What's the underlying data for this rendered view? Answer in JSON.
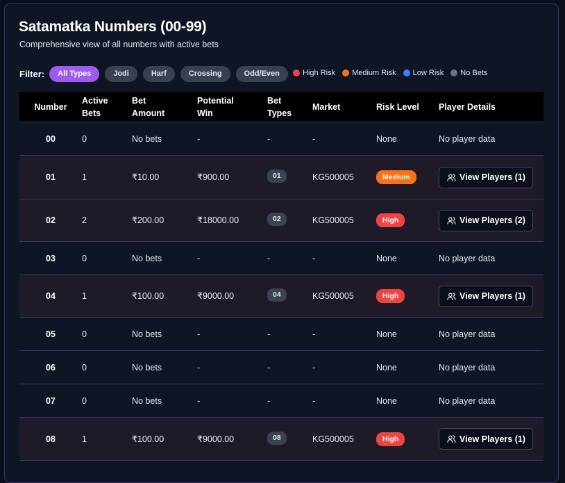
{
  "header": {
    "title": "Satamatka Numbers (00-99)",
    "subtitle": "Comprehensive view of all numbers with active bets"
  },
  "filter": {
    "label": "Filter:",
    "chips": [
      "All Types",
      "Jodi",
      "Harf",
      "Crossing",
      "Odd/Even"
    ],
    "active": "All Types"
  },
  "legend": [
    {
      "label": "High Risk",
      "color": "#ef4444"
    },
    {
      "label": "Medium Risk",
      "color": "#f97316"
    },
    {
      "label": "Low Risk",
      "color": "#3b82f6"
    },
    {
      "label": "No Bets",
      "color": "#6b7280"
    }
  ],
  "table": {
    "columns": {
      "number": "Number",
      "active_bets_1": "Active",
      "active_bets_2": "Bets",
      "bet_amount_1": "Bet",
      "bet_amount_2": "Amount",
      "potential_win_1": "Potential",
      "potential_win_2": "Win",
      "bet_types_1": "Bet",
      "bet_types_2": "Types",
      "market": "Market",
      "risk_level": "Risk Level",
      "player_details": "Player Details"
    },
    "rows": [
      {
        "number": "00",
        "active": "0",
        "amount": "No bets",
        "win": "-",
        "types": "-",
        "market": "-",
        "risk": "None",
        "players": "No player data"
      },
      {
        "number": "01",
        "active": "1",
        "amount": "₹10.00",
        "win": "₹900.00",
        "types": "01",
        "market": "KG500005",
        "risk": "Medium",
        "players": "View Players (1)"
      },
      {
        "number": "02",
        "active": "2",
        "amount": "₹200.00",
        "win": "₹18000.00",
        "types": "02",
        "market": "KG500005",
        "risk": "High",
        "players": "View Players (2)"
      },
      {
        "number": "03",
        "active": "0",
        "amount": "No bets",
        "win": "-",
        "types": "-",
        "market": "-",
        "risk": "None",
        "players": "No player data"
      },
      {
        "number": "04",
        "active": "1",
        "amount": "₹100.00",
        "win": "₹9000.00",
        "types": "04",
        "market": "KG500005",
        "risk": "High",
        "players": "View Players (1)"
      },
      {
        "number": "05",
        "active": "0",
        "amount": "No bets",
        "win": "-",
        "types": "-",
        "market": "-",
        "risk": "None",
        "players": "No player data"
      },
      {
        "number": "06",
        "active": "0",
        "amount": "No bets",
        "win": "-",
        "types": "-",
        "market": "-",
        "risk": "None",
        "players": "No player data"
      },
      {
        "number": "07",
        "active": "0",
        "amount": "No bets",
        "win": "-",
        "types": "-",
        "market": "-",
        "risk": "None",
        "players": "No player data"
      },
      {
        "number": "08",
        "active": "1",
        "amount": "₹100.00",
        "win": "₹9000.00",
        "types": "08",
        "market": "KG500005",
        "risk": "High",
        "players": "View Players (1)"
      }
    ]
  },
  "icons": {
    "view_players": "users-icon"
  }
}
